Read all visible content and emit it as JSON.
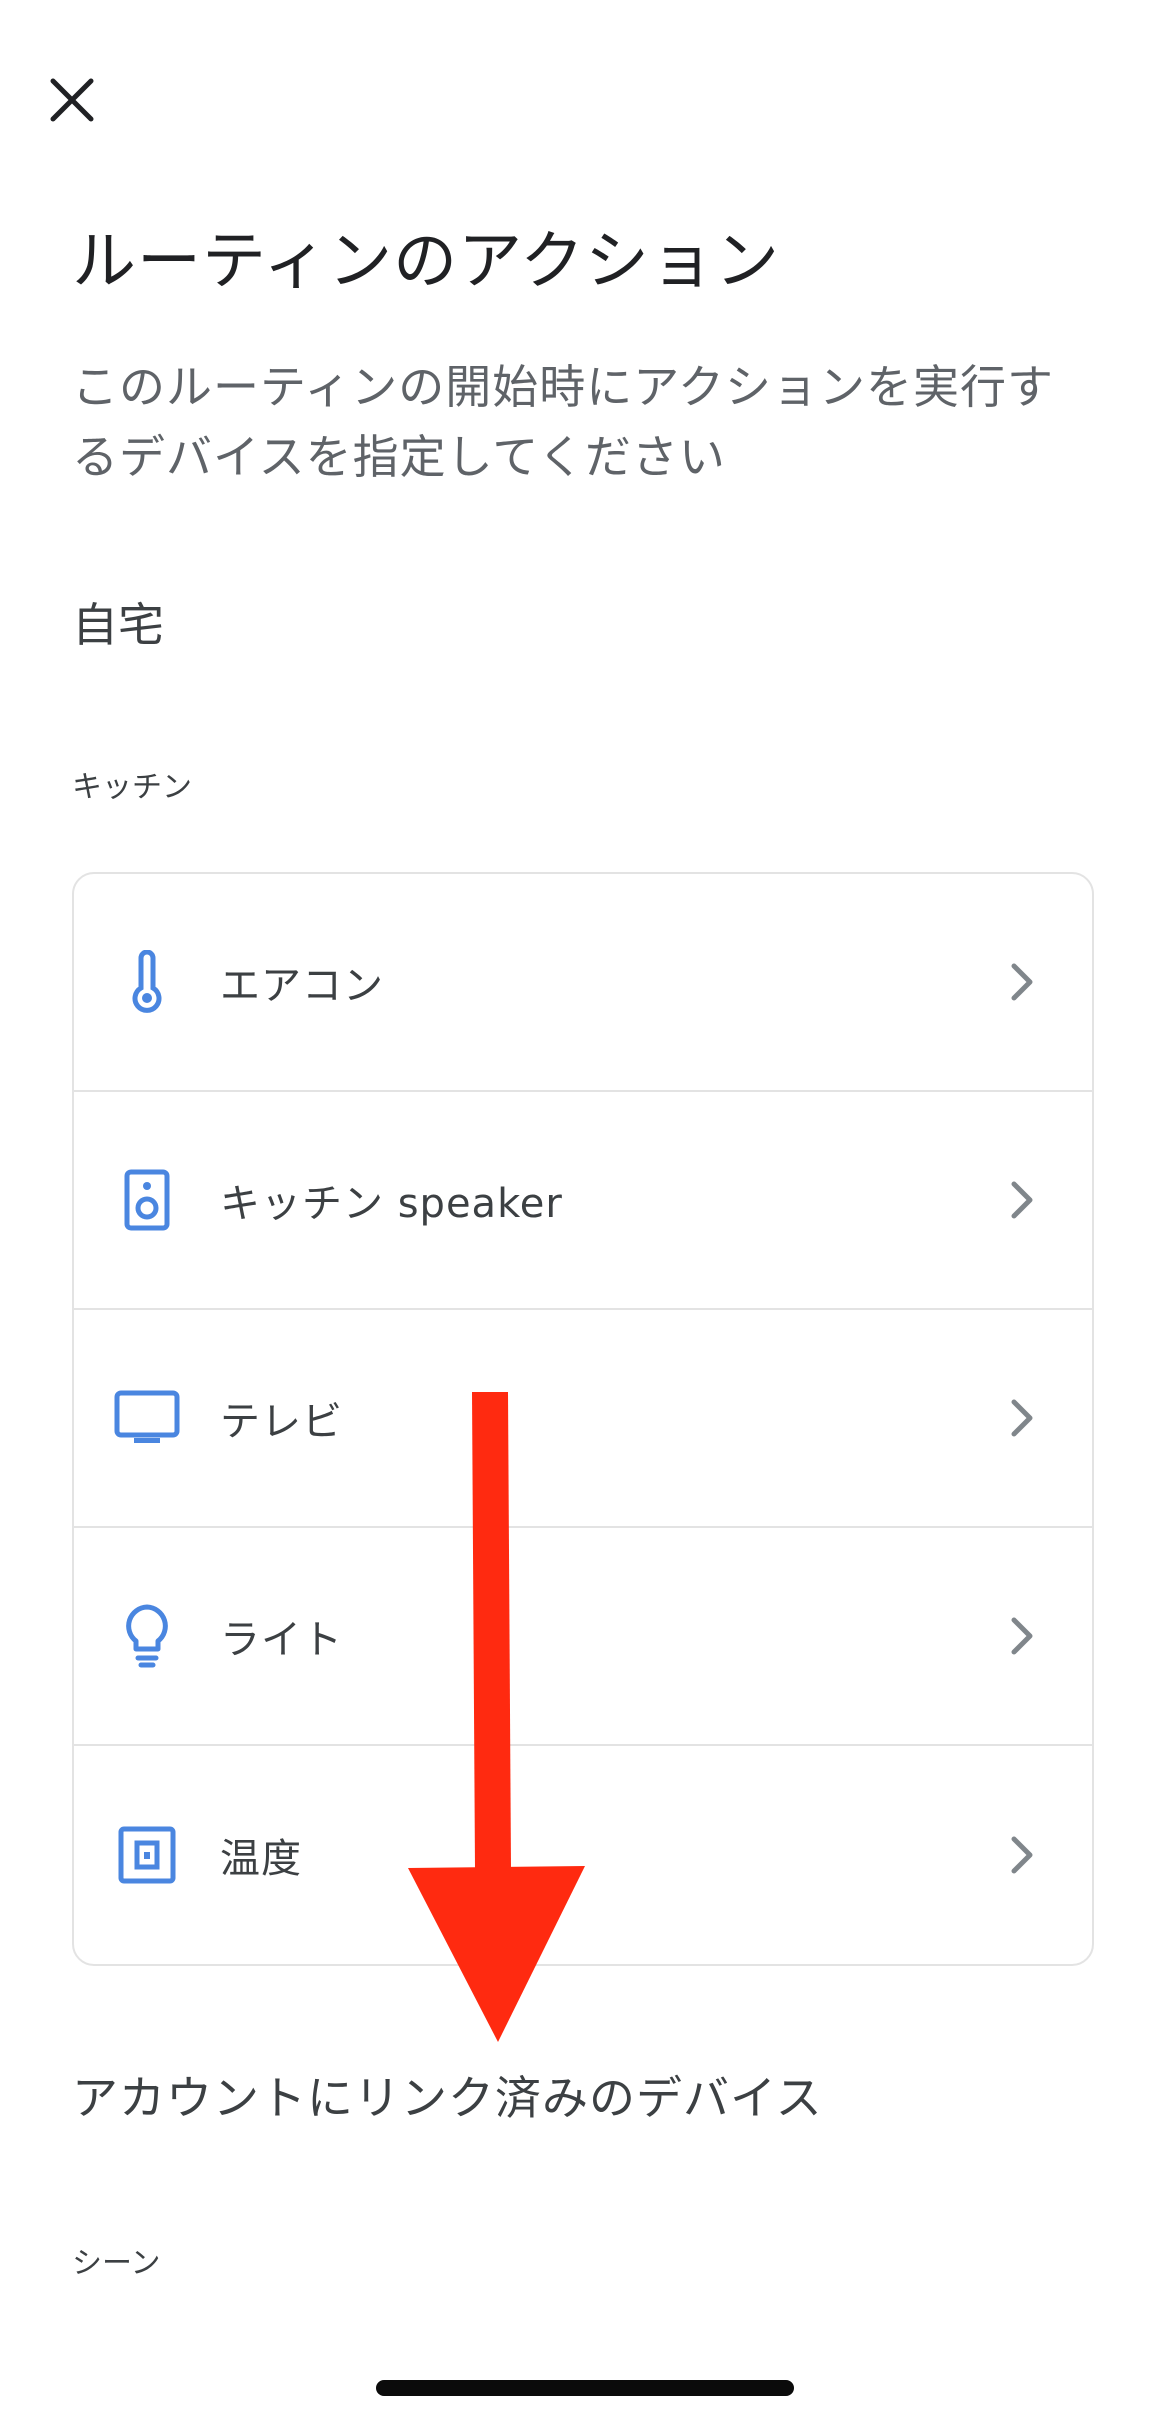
{
  "header": {
    "close_icon": "close-icon",
    "title": "ルーティンのアクション",
    "description": "このルーティンの開始時にアクションを実行するデバイスを指定してください"
  },
  "home": {
    "name": "自宅",
    "room": "キッチン",
    "devices": [
      {
        "label": "エアコン",
        "icon": "thermometer-icon"
      },
      {
        "label": "キッチン speaker",
        "icon": "speaker-icon"
      },
      {
        "label": "テレビ",
        "icon": "tv-icon"
      },
      {
        "label": "ライト",
        "icon": "lightbulb-icon"
      },
      {
        "label": "温度",
        "icon": "thermostat-icon"
      }
    ]
  },
  "linked": {
    "section_title": "アカウントにリンク済みのデバイス",
    "scene_label": "シーン"
  },
  "colors": {
    "icon_blue": "#4a86e0",
    "arrow_red": "#ff2a10",
    "chevron_gray": "#80868b",
    "divider": "#e3e3e3"
  }
}
